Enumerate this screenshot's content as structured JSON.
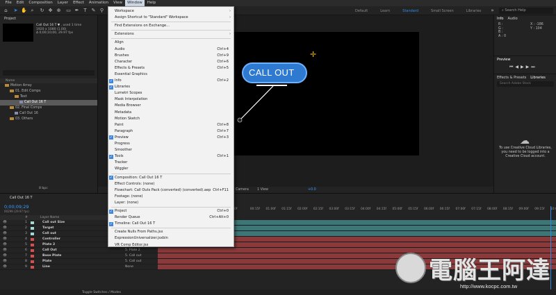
{
  "menubar": [
    "File",
    "Edit",
    "Composition",
    "Layer",
    "Effect",
    "Animation",
    "View",
    "Window",
    "Help"
  ],
  "menubar_active_index": 7,
  "workspaces": [
    "Default",
    "Learn",
    "Standard",
    "Small Screen",
    "Libraries"
  ],
  "workspace_active_index": 2,
  "help_search_placeholder": "Search Help",
  "project": {
    "tab": "Project",
    "comp_name": "Call Out 16 T ▼",
    "used": ", used 1 time",
    "dims": "1920 x 1080 (1.00)",
    "duration": "Δ 0;00;10;00, 29.97 fps",
    "col_header": "Name",
    "tree": [
      {
        "label": "Motion Array",
        "type": "folder",
        "indent": 1
      },
      {
        "label": "01. Edit Comps",
        "type": "folder",
        "indent": 2
      },
      {
        "label": "Text",
        "type": "folder",
        "indent": 3
      },
      {
        "label": "Call Out 16 T",
        "type": "comp",
        "indent": 4,
        "selected": true
      },
      {
        "label": "02. Final Comps",
        "type": "folder",
        "indent": 2
      },
      {
        "label": "Call Out 16",
        "type": "comp",
        "indent": 3
      },
      {
        "label": "03. Others",
        "type": "folder",
        "indent": 2
      }
    ],
    "footer_label": "8 bpc"
  },
  "viewer": {
    "callout_text": "CALL OUT",
    "bar_items": [
      "Camera",
      "1 View",
      "+0.0"
    ]
  },
  "info_panel": {
    "tabs": [
      "Info",
      "Audio"
    ],
    "readouts": [
      "R :",
      "G :",
      "B :",
      "A : 0"
    ],
    "coords": [
      "X : -186",
      "Y : 104"
    ]
  },
  "preview_tab": "Preview",
  "libraries": {
    "tabs": [
      "Effects & Presets",
      "Libraries"
    ],
    "search_placeholder": "Search Adobe Stock",
    "message": "To use Creative Cloud Libraries, you need to be logged into a Creative Cloud account."
  },
  "timeline": {
    "tab": "Call Out 16 T",
    "timecode": "0;00;09;29",
    "frames": "00299 (29.97 fps)",
    "col_labels": [
      "#",
      "Layer Name",
      "Parent & Link"
    ],
    "ruler": [
      "0f",
      "00:15f",
      "01:00f",
      "01:15f",
      "02:00f",
      "02:15f",
      "03:00f",
      "03:15f",
      "04:00f",
      "04:15f",
      "05:00f",
      "05:15f",
      "06:00f",
      "06:15f",
      "07:00f",
      "07:15f",
      "08:00f",
      "08:15f",
      "09:00f",
      "09:15f",
      "10:0"
    ],
    "layers": [
      {
        "num": "1",
        "name": "Call out Size",
        "color": "#a0d7d7",
        "parent": "None"
      },
      {
        "num": "2",
        "name": "Target",
        "color": "#a0d7d7",
        "parent": "None"
      },
      {
        "num": "3",
        "name": "Call out",
        "color": "#a0d7d7",
        "parent": "None"
      },
      {
        "num": "4",
        "name": "Controller",
        "color": "#d84d4d",
        "parent": "None"
      },
      {
        "num": "5",
        "name": "Plate 2",
        "color": "#d84d4d",
        "parent": "None"
      },
      {
        "num": "6",
        "name": "Call Out",
        "color": "#d84d4d",
        "parent": "5. Plate 2"
      },
      {
        "num": "7",
        "name": "Base Plate",
        "color": "#d84d4d",
        "parent": "5. Call out"
      },
      {
        "num": "8",
        "name": "Plate",
        "color": "#d84d4d",
        "parent": "5. Call out"
      },
      {
        "num": "9",
        "name": "Line",
        "color": "#d84d4d",
        "parent": "None"
      }
    ],
    "footer": "Toggle Switches / Modes"
  },
  "window_menu": [
    {
      "label": "Workspace",
      "submenu": true
    },
    {
      "label": "Assign Shortcut to \"Standard\" Workspace",
      "submenu": true
    },
    {
      "sep": true
    },
    {
      "label": "Find Extensions on Exchange..."
    },
    {
      "sep": true
    },
    {
      "label": "Extensions",
      "submenu": true
    },
    {
      "sep": true
    },
    {
      "label": "Align"
    },
    {
      "label": "Audio",
      "shortcut": "Ctrl+4"
    },
    {
      "label": "Brushes",
      "shortcut": "Ctrl+9"
    },
    {
      "label": "Character",
      "shortcut": "Ctrl+6"
    },
    {
      "label": "Effects & Presets",
      "shortcut": "Ctrl+5"
    },
    {
      "label": "Essential Graphics"
    },
    {
      "label": "Info",
      "shortcut": "Ctrl+2",
      "checked": true
    },
    {
      "label": "Libraries",
      "checked": true
    },
    {
      "label": "Lumetri Scopes"
    },
    {
      "label": "Mask Interpolation"
    },
    {
      "label": "Media Browser"
    },
    {
      "label": "Metadata"
    },
    {
      "label": "Motion Sketch"
    },
    {
      "label": "Paint",
      "shortcut": "Ctrl+8"
    },
    {
      "label": "Paragraph",
      "shortcut": "Ctrl+7"
    },
    {
      "label": "Preview",
      "shortcut": "Ctrl+3",
      "checked": true
    },
    {
      "label": "Progress"
    },
    {
      "label": "Smoother"
    },
    {
      "label": "Tools",
      "shortcut": "Ctrl+1",
      "checked": true
    },
    {
      "label": "Tracker"
    },
    {
      "label": "Wiggler"
    },
    {
      "sep": true
    },
    {
      "label": "Composition: Call Out 16 T",
      "checked": true
    },
    {
      "label": "Effect Controls: (none)"
    },
    {
      "label": "Flowchart: Call Outs Pack (converted) (converted).aep",
      "shortcut": "Ctrl+F11"
    },
    {
      "label": "Footage: (none)"
    },
    {
      "label": "Layer: (none)"
    },
    {
      "sep": true
    },
    {
      "label": "Project",
      "shortcut": "Ctrl+0",
      "checked": true
    },
    {
      "label": "Render Queue",
      "shortcut": "Ctrl+Alt+0"
    },
    {
      "label": "Timeline: Call Out 16 T",
      "checked": true
    },
    {
      "sep": true
    },
    {
      "label": "Create Nulls From Paths.jsx"
    },
    {
      "label": "ExpressionUniversalizer.jsxbin"
    },
    {
      "label": "VR Comp Editor.jsx"
    }
  ],
  "watermark": {
    "text": "電腦王阿達",
    "url": "http://www.kocpc.com.tw"
  },
  "colors": {
    "accent": "#2d8ceb",
    "callout_fill": "#2f7ad1",
    "teal_track": "#3c7676",
    "red_track": "#8a3a3a"
  }
}
